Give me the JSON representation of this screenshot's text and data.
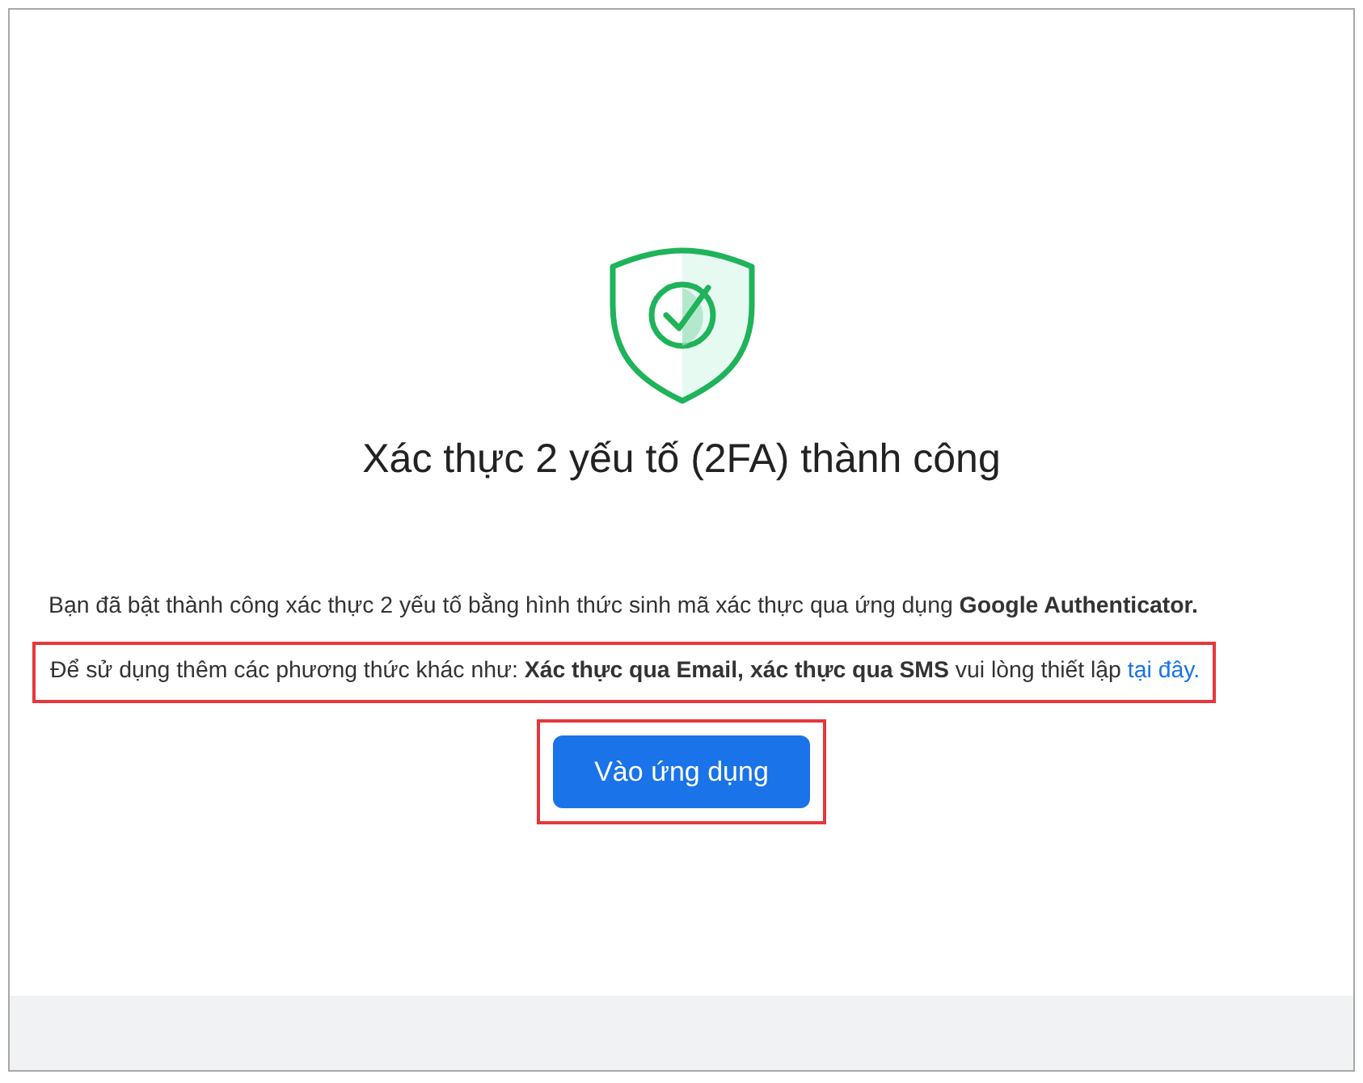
{
  "title": "Xác thực 2 yếu tố (2FA) thành công",
  "message": "Bạn đã bật thành công xác thực 2 yếu tố bằng hình thức sinh mã xác thực qua ứng dụng **Google Authenticator.**",
  "notice": {
    "text": "Để sử dụng thêm các phương thức khác như: **Xác thực qua Email, xác thực qua SMS** vui lòng thiết lập ",
    "link": "tại đây.",
    "highlighted": true
  },
  "button": {
    "label": "Vào ứng dụng",
    "highlighted": true
  }
}
